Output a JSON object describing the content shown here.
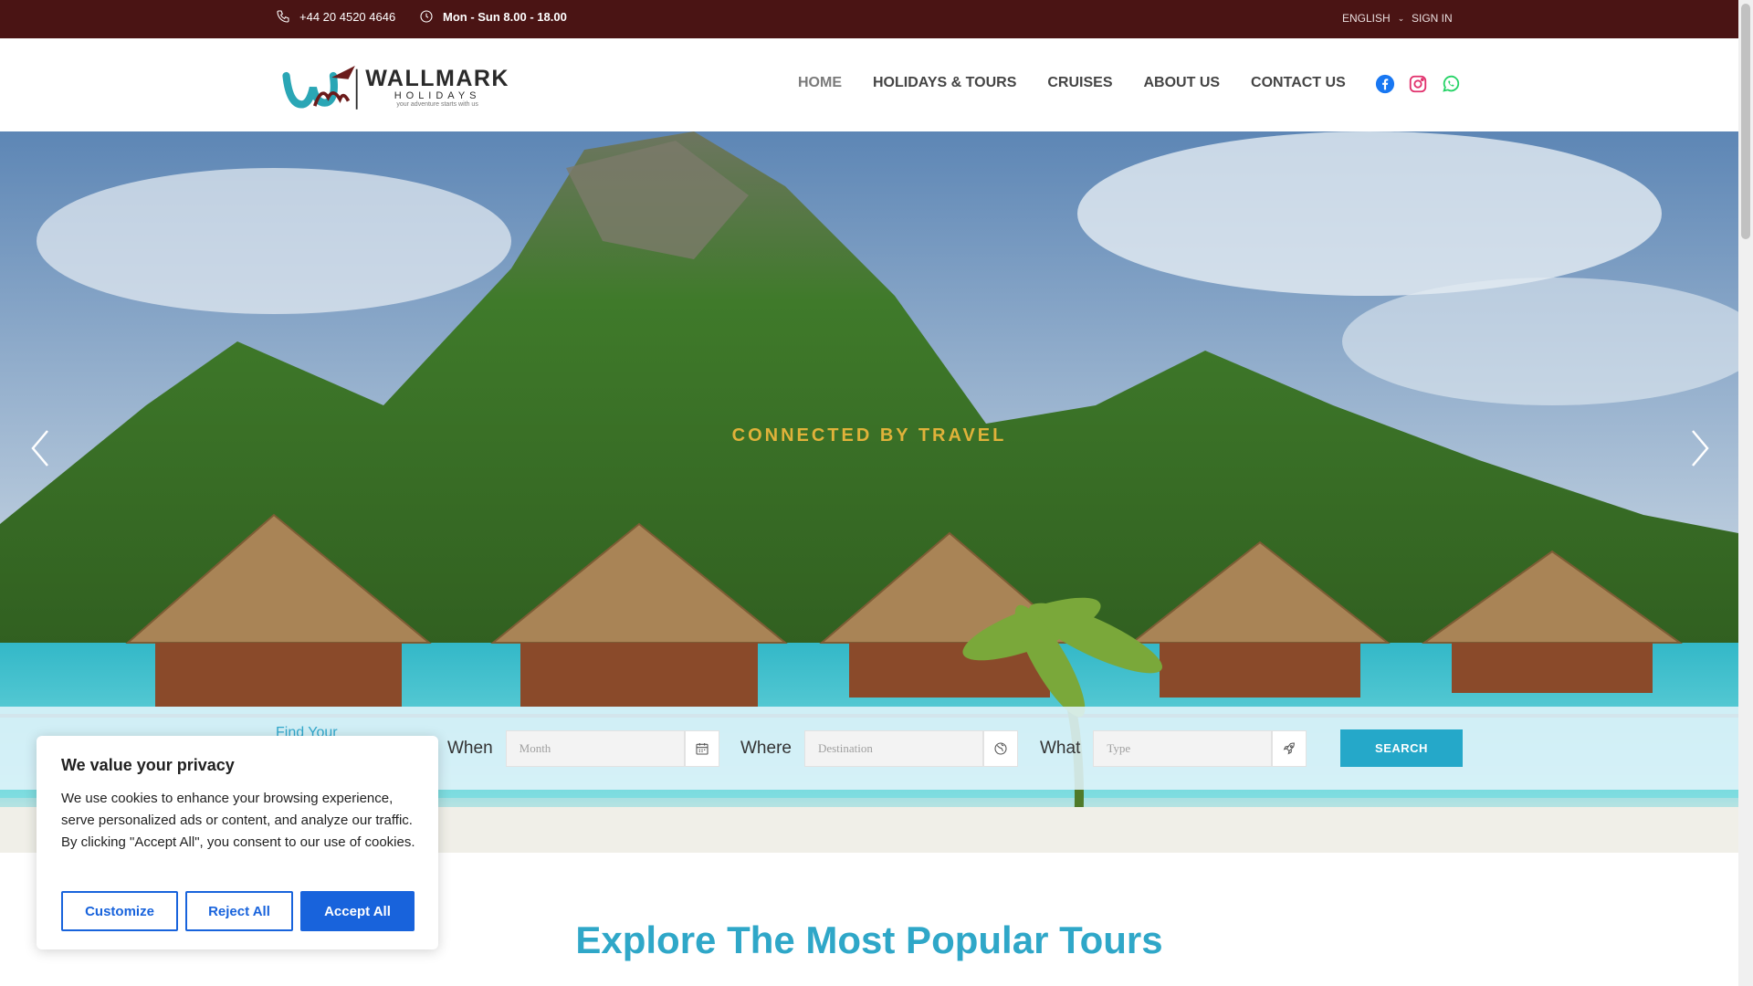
{
  "topbar": {
    "phone": "+44 20 4520 4646",
    "hours": "Mon - Sun 8.00 - 18.00",
    "language": "ENGLISH",
    "signin": "SIGN IN"
  },
  "brand": {
    "name": "WALLMARK",
    "sub": "HOLIDAYS",
    "tagline": "your adventure starts with us"
  },
  "nav": [
    "HOME",
    "HOLIDAYS & TOURS",
    "CRUISES",
    "ABOUT US",
    "CONTACT US"
  ],
  "social": {
    "icons": [
      "facebook-icon",
      "instagram-icon",
      "whatsapp-icon"
    ],
    "colors": {
      "facebook": "#1877f2",
      "instagram": "#e1306c",
      "whatsapp": "#25d366"
    }
  },
  "hero": {
    "tagline": "CONNECTED BY TRAVEL"
  },
  "search": {
    "find": "Find Your",
    "when_label": "When",
    "when_placeholder": "Month",
    "where_label": "Where",
    "where_placeholder": "Destination",
    "what_label": "What",
    "what_placeholder": "Type",
    "button": "SEARCH"
  },
  "section": {
    "title": "Explore The Most Popular Tours"
  },
  "cookie": {
    "title": "We value your privacy",
    "text": "We use cookies to enhance your browsing experience, serve personalized ads or content, and analyze our traffic. By clicking \"Accept All\", you consent to our use of cookies.",
    "customize": "Customize",
    "reject": "Reject All",
    "accept": "Accept All"
  },
  "colors": {
    "topbar": "#4a1414",
    "accent": "#25a8c9",
    "title": "#2fa7c8",
    "cookie_primary": "#1863dc",
    "hero_tagline": "#e0b23a"
  }
}
